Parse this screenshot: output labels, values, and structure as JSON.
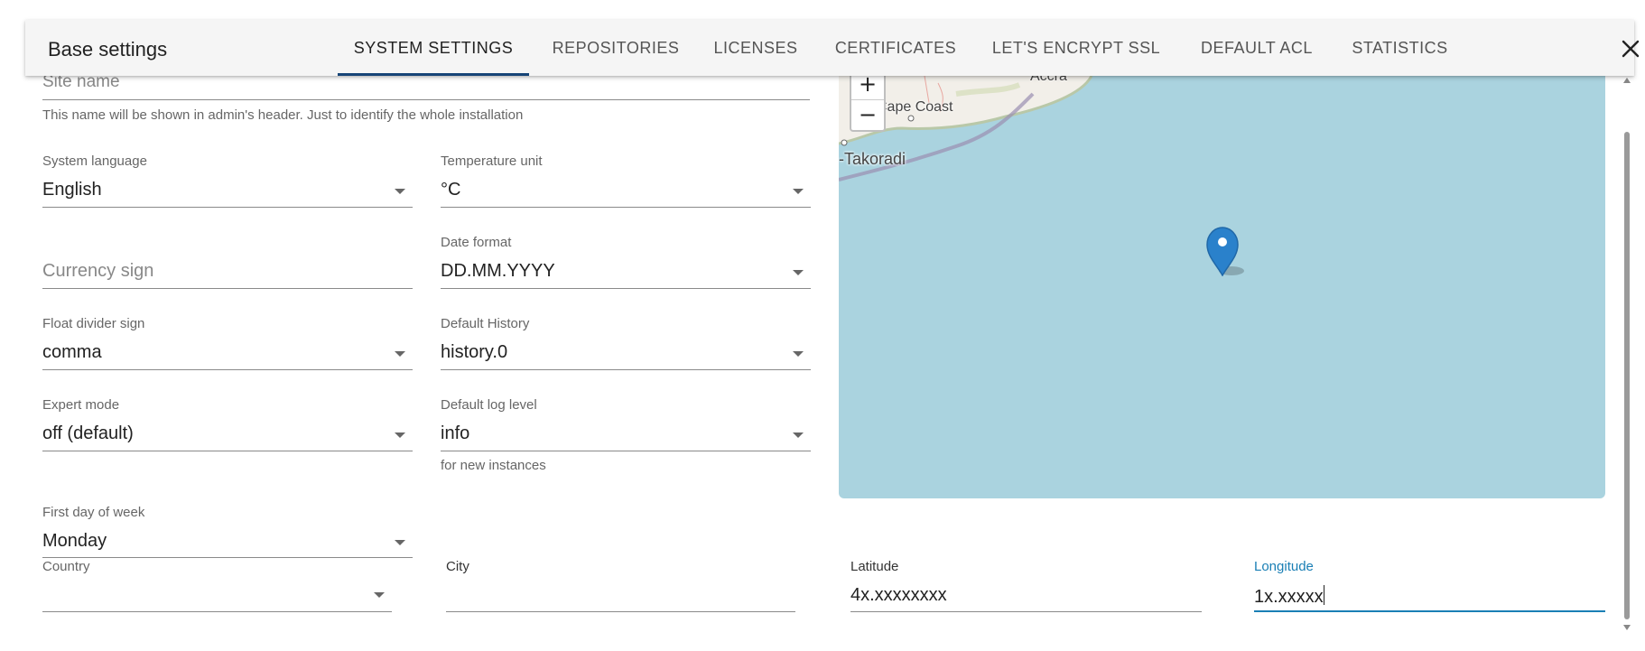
{
  "dialog": {
    "title": "Base settings",
    "tabs": [
      {
        "label": "SYSTEM SETTINGS",
        "active": true
      },
      {
        "label": "REPOSITORIES",
        "active": false
      },
      {
        "label": "LICENSES",
        "active": false
      },
      {
        "label": "CERTIFICATES",
        "active": false
      },
      {
        "label": "LET'S ENCRYPT SSL",
        "active": false
      },
      {
        "label": "DEFAULT ACL",
        "active": false
      },
      {
        "label": "STATISTICS",
        "active": false
      }
    ],
    "close_icon": "close-icon"
  },
  "form": {
    "site_name": {
      "placeholder": "Site name",
      "helper": "This name will be shown in admin's header. Just to identify the whole installation"
    },
    "system_language": {
      "label": "System language",
      "value": "English"
    },
    "temperature_unit": {
      "label": "Temperature unit",
      "value": "°C"
    },
    "currency_sign": {
      "placeholder": "Currency sign"
    },
    "date_format": {
      "label": "Date format",
      "value": "DD.MM.YYYY"
    },
    "float_divider": {
      "label": "Float divider sign",
      "value": "comma"
    },
    "default_history": {
      "label": "Default History",
      "value": "history.0"
    },
    "expert_mode": {
      "label": "Expert mode",
      "value": "off (default)"
    },
    "default_log_level": {
      "label": "Default log level",
      "value": "info",
      "helper": "for new instances"
    },
    "first_day_of_week": {
      "label": "First day of week",
      "value": "Monday"
    },
    "country": {
      "label": "Country",
      "value": ""
    },
    "city": {
      "label": "City",
      "value": ""
    },
    "latitude": {
      "label": "Latitude",
      "value": "4x.xxxxxxxx"
    },
    "longitude": {
      "label": "Longitude",
      "value": "1x.xxxxx"
    }
  },
  "map": {
    "zoom_in": "+",
    "zoom_out": "−",
    "place_labels": [
      "Accra",
      "Cape Coast",
      "-Takoradi"
    ],
    "water_color": "#aad3df",
    "marker_color": "#2a81cb"
  },
  "colors": {
    "accent": "#164477",
    "focus": "#1a7fb5"
  }
}
